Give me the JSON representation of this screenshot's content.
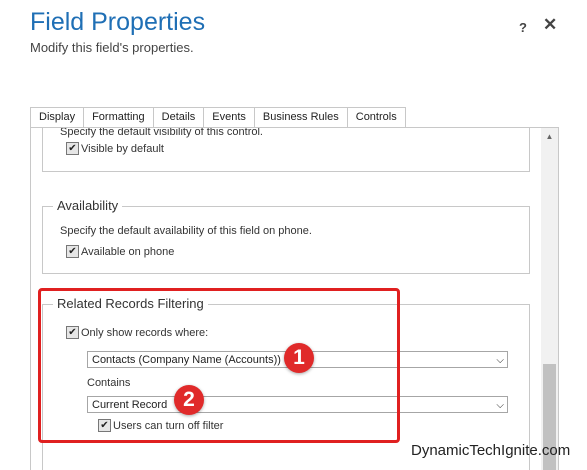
{
  "dialog": {
    "title": "Field Properties",
    "subtitle": "Modify this field's properties.",
    "help_label": "?",
    "close_label": "✕"
  },
  "tabs": [
    {
      "label": "Display",
      "active": true
    },
    {
      "label": "Formatting"
    },
    {
      "label": "Details"
    },
    {
      "label": "Events"
    },
    {
      "label": "Business Rules"
    },
    {
      "label": "Controls"
    }
  ],
  "visibility": {
    "description": "Specify the default visibility of this control.",
    "checkbox_label": "Visible by default",
    "checked": true
  },
  "availability": {
    "legend": "Availability",
    "description": "Specify the default availability of this field on phone.",
    "checkbox_label": "Available on phone",
    "checked": true
  },
  "related_records": {
    "legend": "Related Records Filtering",
    "only_show_label": "Only show records where:",
    "only_show_checked": true,
    "relationship_value": "Contacts (Company Name (Accounts))",
    "contains_label": "Contains",
    "contains_value": "Current Record",
    "users_can_turn_off_label": "Users can turn off filter",
    "users_can_turn_off_checked": true
  },
  "markers": [
    "1",
    "2"
  ],
  "watermark": "DynamicTechIgnite.com",
  "colors": {
    "title": "#1f6fb5",
    "highlight": "#e02020",
    "marker": "#e02a2a"
  },
  "icons": {
    "check": "✔",
    "chevron": "⌵"
  }
}
